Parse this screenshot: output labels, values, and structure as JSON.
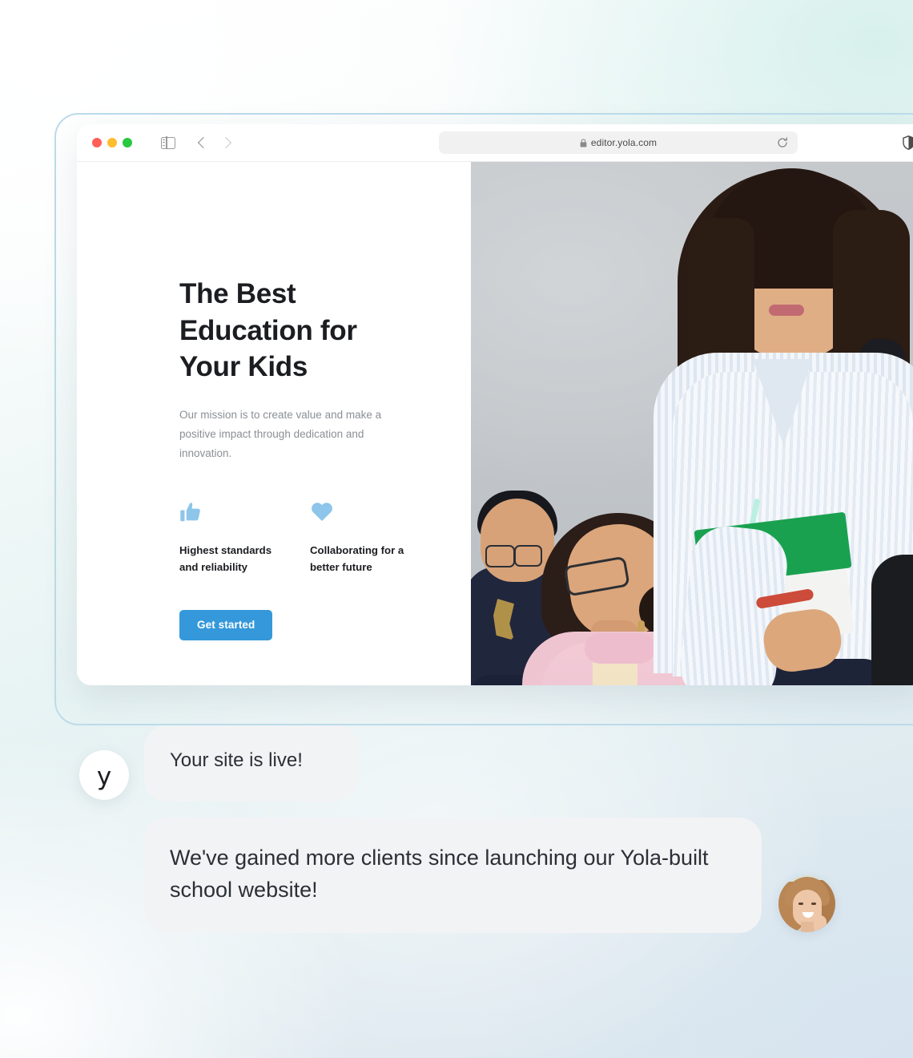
{
  "browser": {
    "traffic_lights": [
      "close-red",
      "minimize-yellow",
      "maximize-green"
    ],
    "sidebar_toggle_icon": "sidebar-icon",
    "back_icon": "chevron-left-icon",
    "forward_icon": "chevron-right-icon",
    "shield_icon": "privacy-shield-icon",
    "lock_icon": "lock-icon",
    "url": "editor.yola.com",
    "reload_icon": "reload-icon"
  },
  "hero": {
    "title": "The Best Education for Your Kids",
    "subtitle": "Our mission is to create value and make a positive impact through dedication and innovation.",
    "features": [
      {
        "icon": "thumbs-up-icon",
        "label": "Highest standards and reliability"
      },
      {
        "icon": "heart-icon",
        "label": "Collaborating for a better future"
      }
    ],
    "cta_label": "Get started",
    "image_alt": "Students in a classroom, one standing holding a green notebook"
  },
  "chat": {
    "brand_avatar_letter": "y",
    "messages": [
      {
        "from": "yola",
        "text": "Your site is live!"
      },
      {
        "from": "customer",
        "text": "We've gained more clients since launching our Yola-built school website!"
      }
    ],
    "customer_avatar_alt": "Smiling woman portrait"
  },
  "colors": {
    "accent_blue": "#3498db",
    "feature_icon_blue": "#8ec5ea",
    "bubble_bg": "#f2f3f5",
    "text_dark": "#1b1d21",
    "text_muted": "#8b8f94",
    "frame_outline": "#bcdcea"
  }
}
